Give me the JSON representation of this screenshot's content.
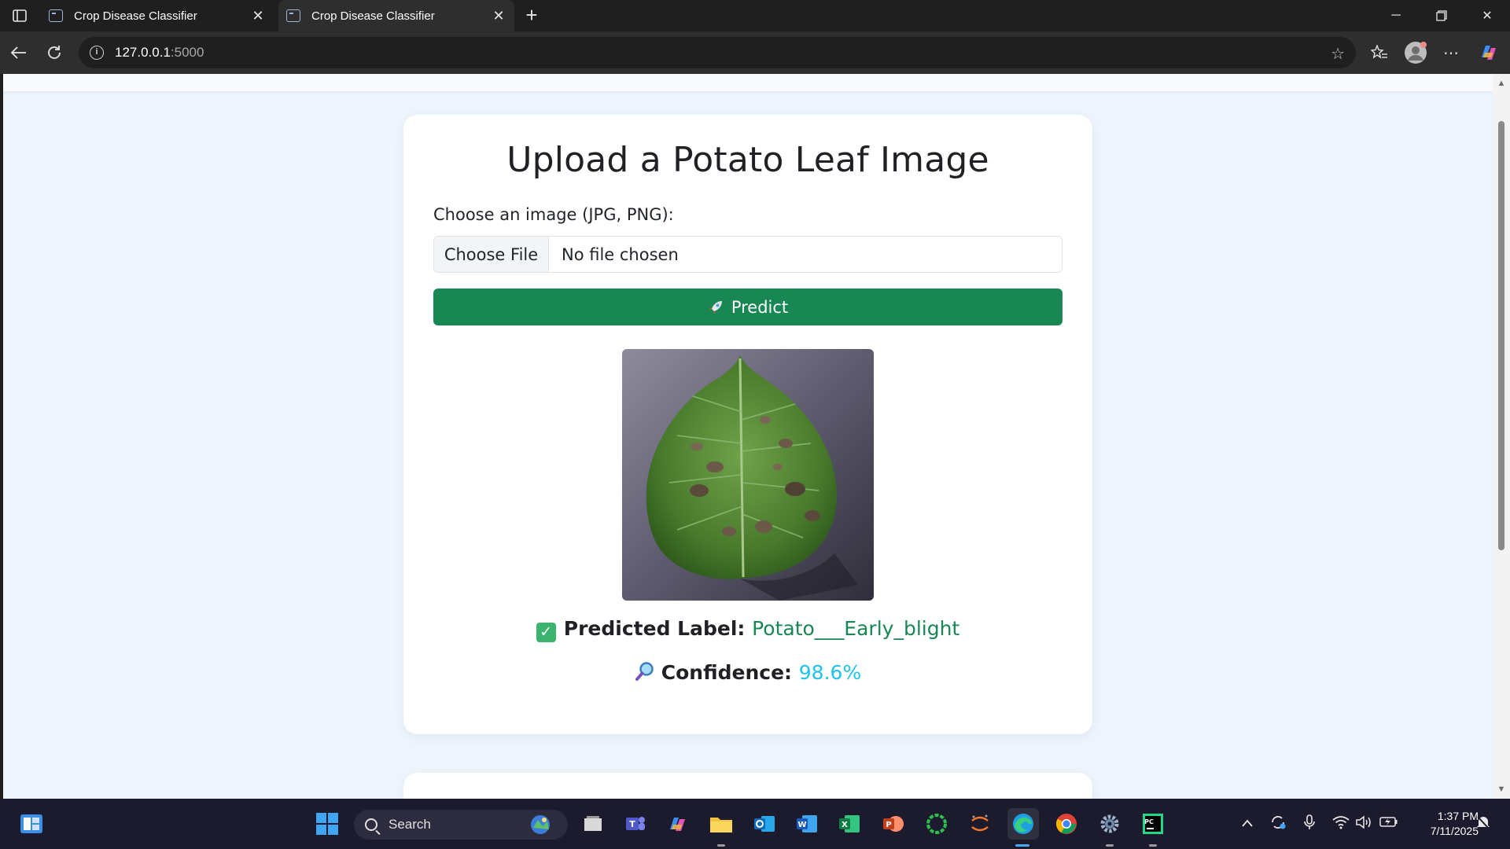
{
  "browser": {
    "tabs": [
      {
        "title": "Crop Disease Classifier",
        "active": false
      },
      {
        "title": "Crop Disease Classifier",
        "active": true
      }
    ],
    "url_host": "127.0.0.1",
    "url_port": ":5000"
  },
  "page": {
    "title": "Upload a Potato Leaf Image",
    "file_label": "Choose an image (JPG, PNG):",
    "file_button": "Choose File",
    "file_status": "No file chosen",
    "predict_button": "Predict",
    "image_alt": "potato leaf with early blight spots",
    "predicted_label_caption": "Predicted Label:",
    "predicted_label_value": "Potato___Early_blight",
    "confidence_caption": "Confidence:",
    "confidence_value": "98.6%"
  },
  "taskbar": {
    "search_placeholder": "Search",
    "time": "1:37 PM",
    "date": "7/11/2025"
  },
  "colors": {
    "success": "#198754",
    "confidence": "#1cc3ea",
    "page_bg": "#eef5fd"
  }
}
